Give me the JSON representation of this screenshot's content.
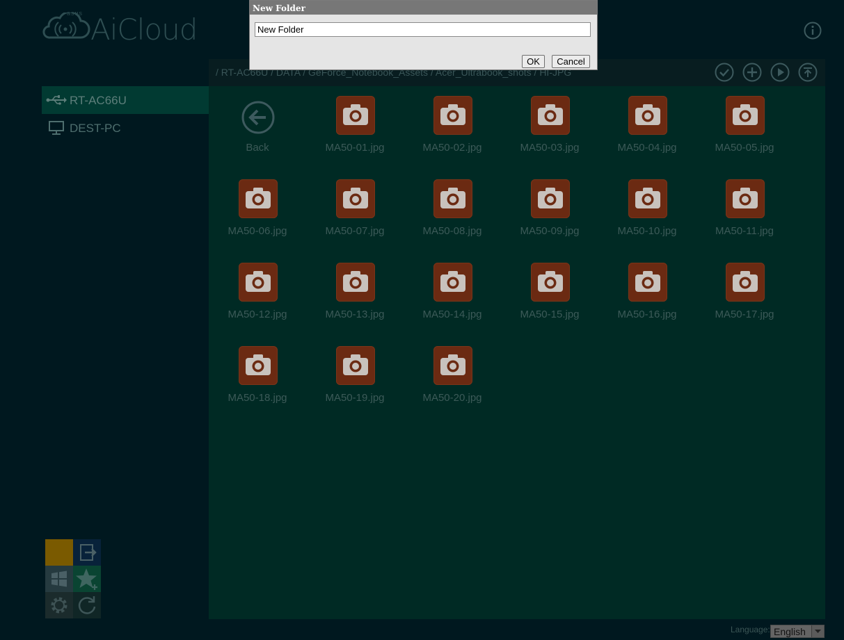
{
  "app": {
    "brand": "asus",
    "title": "AiCloud"
  },
  "toolbar": {
    "breadcrumb": "/ RT-AC66U / DATA / GeForce_Notebook_Assets / Acer_Ultrabook_shots / HI-JPG",
    "buttons": [
      "check-icon",
      "plus-icon",
      "play-icon",
      "upload-icon"
    ]
  },
  "sidebar": {
    "items": [
      {
        "label": "RT-AC66U",
        "icon": "usb-icon",
        "active": true
      },
      {
        "label": "DEST-PC",
        "icon": "monitor-icon",
        "active": false
      }
    ]
  },
  "files": {
    "back_label": "Back",
    "items": [
      "MA50-01.jpg",
      "MA50-02.jpg",
      "MA50-03.jpg",
      "MA50-04.jpg",
      "MA50-05.jpg",
      "MA50-06.jpg",
      "MA50-07.jpg",
      "MA50-08.jpg",
      "MA50-09.jpg",
      "MA50-10.jpg",
      "MA50-11.jpg",
      "MA50-12.jpg",
      "MA50-13.jpg",
      "MA50-14.jpg",
      "MA50-15.jpg",
      "MA50-16.jpg",
      "MA50-17.jpg",
      "MA50-18.jpg",
      "MA50-19.jpg",
      "MA50-20.jpg"
    ]
  },
  "language": {
    "label": "Language:",
    "selected": "English"
  },
  "dialog": {
    "title": "New Folder",
    "input_value": "New Folder",
    "ok_label": "OK",
    "cancel_label": "Cancel"
  },
  "colors": {
    "background": "#00181f",
    "panel": "#002a24",
    "active_item": "#013a32",
    "thumb": "#6b2a12",
    "quick_tile_yellow": "#7a5a00"
  }
}
